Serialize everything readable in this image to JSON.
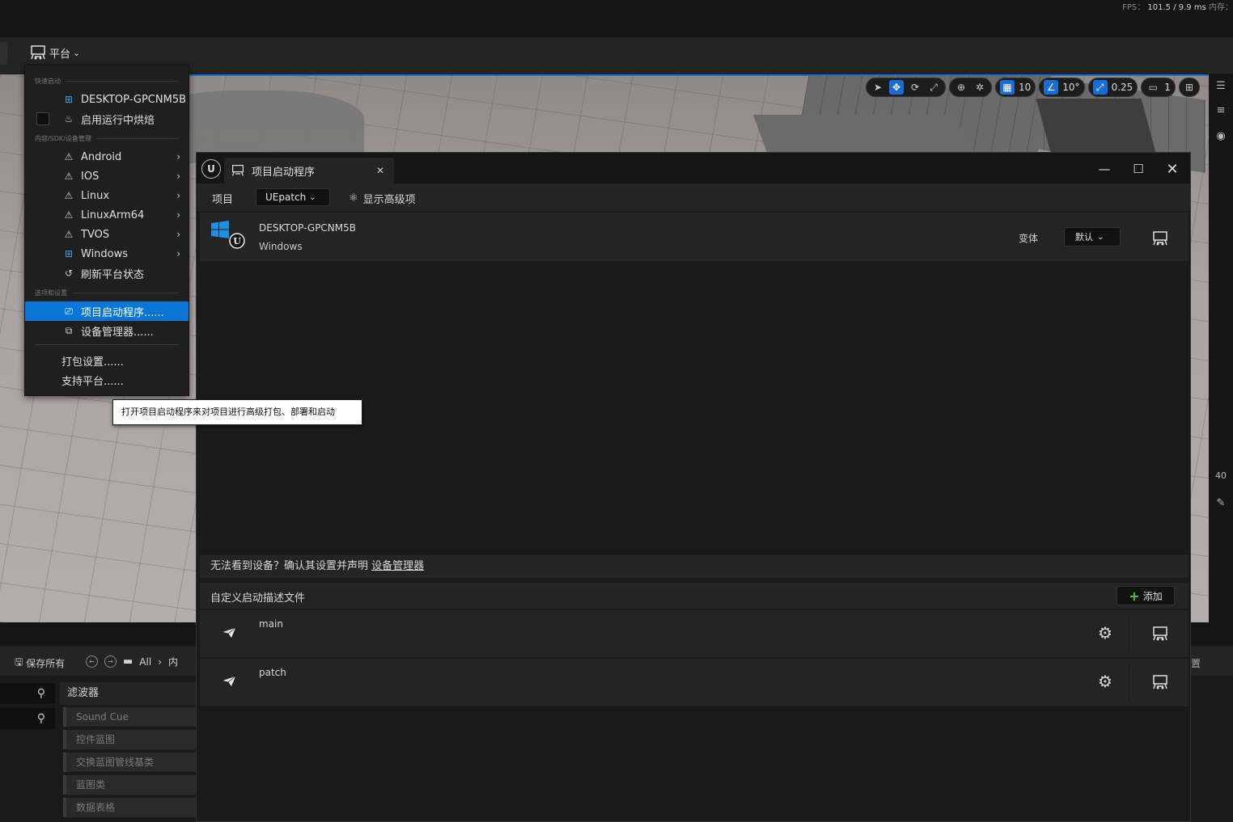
{
  "stats": {
    "fps_label": "FPS：",
    "fps_value": "101.5",
    "frame_time": "/ 9.9 ms",
    "memory_label": "内存："
  },
  "toolbar": {
    "platform_label": "平台"
  },
  "viewport_tools": {
    "grid_snap": "10",
    "angle_snap": "10°",
    "scale_snap": "0.25",
    "camera_speed": "1"
  },
  "right_panel": {
    "value": "40"
  },
  "platform_menu": {
    "section_quick_launch": "快速启动",
    "quick_launch_device": "DESKTOP-GPCNM5B",
    "enable_cook_on_fly": "启用运行中烘焙",
    "section_content_sdk": "内容/SDK/设备管理",
    "platforms": [
      "Android",
      "IOS",
      "Linux",
      "LinuxArm64",
      "TVOS",
      "Windows"
    ],
    "refresh_status": "刷新平台状态",
    "section_options": "选项和设置",
    "project_launcher": "项目启动程序......",
    "device_manager": "设备管理器......",
    "packaging_settings": "打包设置......",
    "supported_platforms": "支持平台......"
  },
  "tooltip": {
    "text": "打开项目启动程序来对项目进行高级打包、部署和启动"
  },
  "launcher": {
    "tab_title": "项目启动程序",
    "project_label": "项目",
    "project_value": "UEpatch",
    "show_advanced": "显示高级项",
    "device": {
      "name": "DESKTOP-GPCNM5B",
      "os": "Windows",
      "variant_label": "变体",
      "variant_value": "默认"
    },
    "device_hint": "无法看到设备？确认其设置并声明 ",
    "device_hint_link": "设备管理器",
    "profiles_label": "自定义启动描述文件",
    "add_label": "添加",
    "profiles": [
      {
        "name": "main"
      },
      {
        "name": "patch"
      }
    ]
  },
  "content_browser": {
    "save_all": "保存所有",
    "path_root": "All",
    "path_next": "内",
    "filters_title": "滤波器",
    "filters": [
      "Sound Cue",
      "控件蓝图",
      "交换蓝图管线基类",
      "蓝图类",
      "数据表格"
    ],
    "right_label": "置"
  }
}
